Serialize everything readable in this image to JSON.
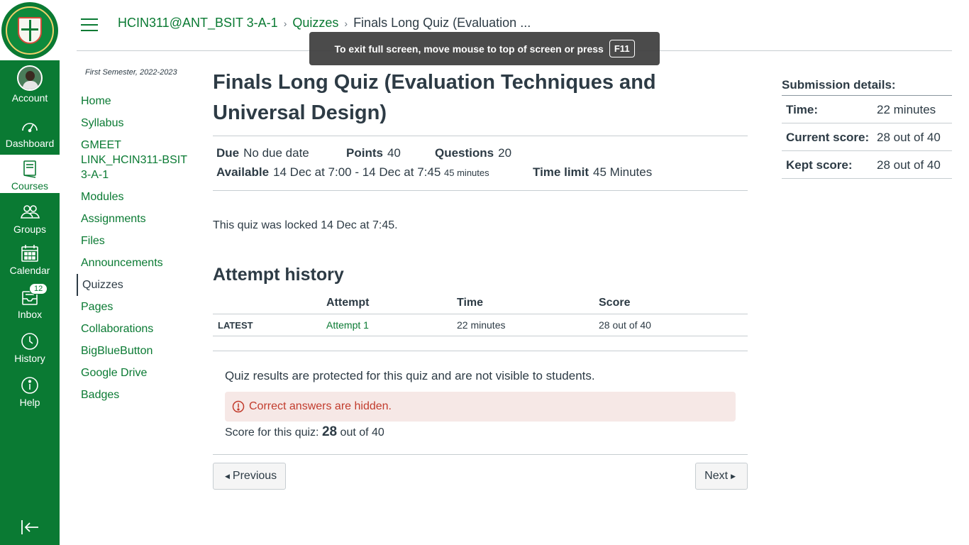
{
  "global_nav": {
    "items": [
      {
        "label": "Account",
        "icon": "avatar"
      },
      {
        "label": "Dashboard",
        "icon": "dashboard-icon"
      },
      {
        "label": "Courses",
        "icon": "courses-icon"
      },
      {
        "label": "Groups",
        "icon": "groups-icon"
      },
      {
        "label": "Calendar",
        "icon": "calendar-icon"
      },
      {
        "label": "Inbox",
        "icon": "inbox-icon",
        "badge": "12"
      },
      {
        "label": "History",
        "icon": "history-icon"
      },
      {
        "label": "Help",
        "icon": "help-icon"
      }
    ],
    "accent": "#0a7a33"
  },
  "breadcrumb": {
    "course": "HCIN311@ANT_BSIT 3-A-1",
    "section": "Quizzes",
    "current": "Finals Long Quiz (Evaluation ..."
  },
  "fullscreen_tip": {
    "text": "To exit full screen, move mouse to top of screen or press",
    "key": "F11"
  },
  "course_nav": {
    "term": "First Semester, 2022-2023",
    "items": [
      "Home",
      "Syllabus",
      "GMEET LINK_HCIN311-BSIT 3-A-1",
      "Modules",
      "Assignments",
      "Files",
      "Announcements",
      "Quizzes",
      "Pages",
      "Collaborations",
      "BigBlueButton",
      "Google Drive",
      "Badges"
    ],
    "active": "Quizzes"
  },
  "quiz": {
    "title": "Finals Long Quiz (Evaluation Techniques and Universal Design)",
    "due_label": "Due",
    "due_value": "No due date",
    "points_label": "Points",
    "points_value": "40",
    "questions_label": "Questions",
    "questions_value": "20",
    "available_label": "Available",
    "available_value": "14 Dec at 7:00 - 14 Dec at 7:45",
    "available_duration": "45 minutes",
    "time_limit_label": "Time limit",
    "time_limit_value": "45 Minutes",
    "locked_text": "This quiz was locked 14 Dec at 7:45.",
    "attempt_history_title": "Attempt history",
    "table_headers": [
      "",
      "Attempt",
      "Time",
      "Score"
    ],
    "table_rows": [
      {
        "tag": "LATEST",
        "attempt": "Attempt 1",
        "time": "22 minutes",
        "score": "28 out of 40"
      }
    ],
    "protected_text": "Quiz results are protected for this quiz and are not visible to students.",
    "alert_text": "Correct answers are hidden.",
    "score_prefix": "Score for this quiz:",
    "score_value": "28",
    "score_suffix": "out of 40",
    "prev_label": "Previous",
    "next_label": "Next"
  },
  "submission": {
    "title": "Submission details:",
    "rows": [
      {
        "label": "Time:",
        "value": "22 minutes"
      },
      {
        "label": "Current score:",
        "value": "28 out of 40"
      },
      {
        "label": "Kept score:",
        "value": "28 out of 40"
      }
    ]
  }
}
